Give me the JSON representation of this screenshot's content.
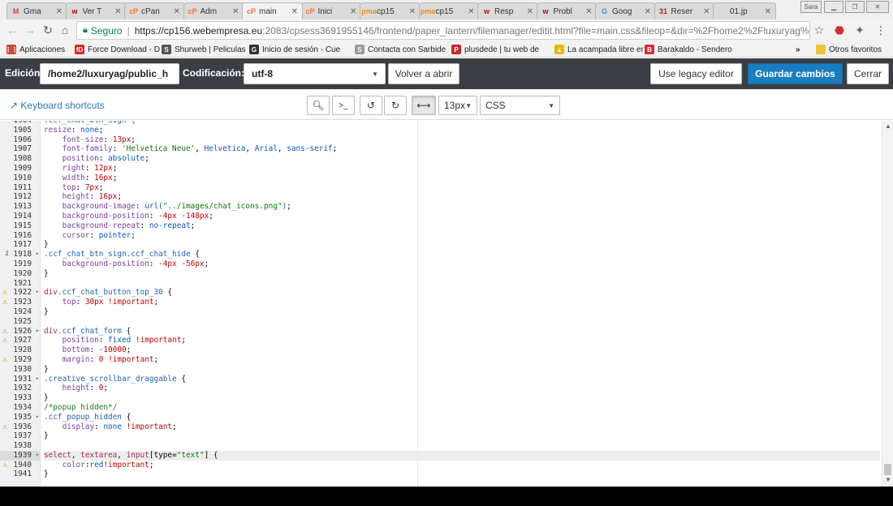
{
  "tabs": [
    {
      "label": "Gma",
      "icon": "gmail-icon",
      "fav": "M",
      "color": "#d44638"
    },
    {
      "label": "Ver T",
      "icon": "webempresa-icon",
      "fav": "w",
      "color": "#cc0000"
    },
    {
      "label": "cPan",
      "icon": "cpanel-icon",
      "fav": "cP",
      "color": "#ff6c2c"
    },
    {
      "label": "Adm",
      "icon": "cpanel-icon",
      "fav": "cP",
      "color": "#ff6c2c"
    },
    {
      "label": "main",
      "icon": "cpanel-icon",
      "fav": "cP",
      "color": "#ff6c2c"
    },
    {
      "label": "Inici",
      "icon": "cpanel-icon",
      "fav": "cP",
      "color": "#ff6c2c"
    },
    {
      "label": "cp15",
      "icon": "phpmyadmin-icon",
      "fav": "pma",
      "color": "#f29111"
    },
    {
      "label": "cp15",
      "icon": "phpmyadmin-icon",
      "fav": "pma",
      "color": "#f29111"
    },
    {
      "label": "Resp",
      "icon": "webempresa-icon",
      "fav": "w",
      "color": "#cc0000"
    },
    {
      "label": "Probl",
      "icon": "webempresa-icon",
      "fav": "w",
      "color": "#cc0000"
    },
    {
      "label": "Goog",
      "icon": "google-translate-icon",
      "fav": "G",
      "color": "#4285f4"
    },
    {
      "label": "Reser",
      "icon": "calendar-icon",
      "fav": "31",
      "color": "#b22222"
    },
    {
      "label": "01.jp",
      "icon": "image-icon",
      "fav": "",
      "color": "#888888"
    }
  ],
  "window": {
    "user": "Sara"
  },
  "toolbar": {
    "secure_label": "Seguro",
    "url_main": "https://cp156.webempresa.eu",
    "url_rest": ":2083/cpsess3691955146/frontend/paper_lantern/filemanager/editit.html?file=main.css&fileop=&dir=%2Fhome2%2Fluxuryag%2..."
  },
  "bookmarks": [
    {
      "label": "Aplicaciones",
      "icon": "apps-icon",
      "fav": "⋮⋮",
      "color": "#d44638"
    },
    {
      "label": "Force Download - De",
      "icon": "force-download-icon",
      "fav": "fD",
      "color": "#e02424"
    },
    {
      "label": "Shurweb | Peliculas y",
      "icon": "shurweb-icon",
      "fav": "S",
      "color": "#555555"
    },
    {
      "label": "Inicio de sesión - Cue",
      "icon": "google-icon",
      "fav": "G",
      "color": "#333333"
    },
    {
      "label": "Contacta con Sarbide",
      "icon": "sarbide-icon",
      "fav": "S",
      "color": "#9a9a9a"
    },
    {
      "label": "plusdede | tu web de",
      "icon": "plusdede-icon",
      "fav": "P",
      "color": "#c62828"
    },
    {
      "label": "La acampada libre en",
      "icon": "acampada-icon",
      "fav": "▲",
      "color": "#f0b400"
    },
    {
      "label": "Barakaldo - Sendero",
      "icon": "barakaldo-icon",
      "fav": "B",
      "color": "#d32f2f"
    },
    {
      "label": "»",
      "icon": "more-bookmarks-icon",
      "fav": "",
      "color": "#333333"
    },
    {
      "label": "Otros favoritos",
      "icon": "folder-icon",
      "fav": "",
      "color": "#f4c430"
    }
  ],
  "editbar": {
    "edition_label": "Edición:",
    "path_value": "/home2/luxuryag/public_h",
    "encoding_label": "Codificación:",
    "encoding_value": "utf-8",
    "reopen_label": "Volver a abrir",
    "legacy_label": "Use legacy editor",
    "save_label": "Guardar cambios",
    "close_label": "Cerrar"
  },
  "subbar": {
    "keyboard_shortcuts": "Keyboard shortcuts",
    "font_size": "13px",
    "mode": "CSS"
  },
  "code_lines": [
    {
      "n": "1904",
      "ann": "",
      "fold": "▾",
      "code": [
        [
          "t-cls",
          ".ccf_chat_btn_sign {"
        ]
      ]
    },
    {
      "n": "1905",
      "ann": "",
      "fold": "",
      "code": [
        [
          "t-prop",
          "resize"
        ],
        [
          "",
          ": "
        ],
        [
          "t-val",
          "none"
        ],
        [
          "",
          ";"
        ]
      ]
    },
    {
      "n": "1906",
      "ann": "",
      "fold": "",
      "code": [
        [
          "",
          "    "
        ],
        [
          "t-prop",
          "font-size"
        ],
        [
          "",
          ": "
        ],
        [
          "t-num",
          "13px"
        ],
        [
          "",
          ";"
        ]
      ]
    },
    {
      "n": "1907",
      "ann": "",
      "fold": "",
      "code": [
        [
          "",
          "    "
        ],
        [
          "t-prop",
          "font-family"
        ],
        [
          "",
          ": "
        ],
        [
          "t-str",
          "'Helvetica Neue'"
        ],
        [
          "",
          ", "
        ],
        [
          "t-val",
          "Helvetica"
        ],
        [
          "",
          ", "
        ],
        [
          "t-val",
          "Arial"
        ],
        [
          "",
          ", "
        ],
        [
          "t-val",
          "sans-serif"
        ],
        [
          "",
          ";"
        ]
      ]
    },
    {
      "n": "1908",
      "ann": "",
      "fold": "",
      "code": [
        [
          "",
          "    "
        ],
        [
          "t-prop",
          "position"
        ],
        [
          "",
          ": "
        ],
        [
          "t-val",
          "absolute"
        ],
        [
          "",
          ";"
        ]
      ]
    },
    {
      "n": "1909",
      "ann": "",
      "fold": "",
      "code": [
        [
          "",
          "    "
        ],
        [
          "t-prop",
          "right"
        ],
        [
          "",
          ": "
        ],
        [
          "t-num",
          "12px"
        ],
        [
          "",
          ";"
        ]
      ]
    },
    {
      "n": "1910",
      "ann": "",
      "fold": "",
      "code": [
        [
          "",
          "    "
        ],
        [
          "t-prop",
          "width"
        ],
        [
          "",
          ": "
        ],
        [
          "t-num",
          "16px"
        ],
        [
          "",
          ";"
        ]
      ]
    },
    {
      "n": "1911",
      "ann": "",
      "fold": "",
      "code": [
        [
          "",
          "    "
        ],
        [
          "t-prop",
          "top"
        ],
        [
          "",
          ": "
        ],
        [
          "t-num",
          "7px"
        ],
        [
          "",
          ";"
        ]
      ]
    },
    {
      "n": "1912",
      "ann": "",
      "fold": "",
      "code": [
        [
          "",
          "    "
        ],
        [
          "t-prop",
          "height"
        ],
        [
          "",
          ": "
        ],
        [
          "t-num",
          "16px"
        ],
        [
          "",
          ";"
        ]
      ]
    },
    {
      "n": "1913",
      "ann": "",
      "fold": "",
      "code": [
        [
          "",
          "    "
        ],
        [
          "t-prop",
          "background-image"
        ],
        [
          "",
          ": "
        ],
        [
          "t-val",
          "url("
        ],
        [
          "t-str",
          "\"../images/chat_icons.png\""
        ],
        [
          "t-val",
          ")"
        ],
        [
          "",
          ";"
        ]
      ]
    },
    {
      "n": "1914",
      "ann": "",
      "fold": "",
      "code": [
        [
          "",
          "    "
        ],
        [
          "t-prop",
          "background-position"
        ],
        [
          "",
          ": "
        ],
        [
          "t-num",
          "-4px -148px"
        ],
        [
          "",
          ";"
        ]
      ]
    },
    {
      "n": "1915",
      "ann": "",
      "fold": "",
      "code": [
        [
          "",
          "    "
        ],
        [
          "t-prop",
          "background-repeat"
        ],
        [
          "",
          ": "
        ],
        [
          "t-val",
          "no-repeat"
        ],
        [
          "",
          ";"
        ]
      ]
    },
    {
      "n": "1916",
      "ann": "",
      "fold": "",
      "code": [
        [
          "",
          "    "
        ],
        [
          "t-prop",
          "cursor"
        ],
        [
          "",
          ": "
        ],
        [
          "t-val",
          "pointer"
        ],
        [
          "",
          ";"
        ]
      ]
    },
    {
      "n": "1917",
      "ann": "",
      "fold": "",
      "code": [
        [
          "",
          "}"
        ]
      ]
    },
    {
      "n": "1918",
      "ann": "info",
      "fold": "▾",
      "code": [
        [
          "t-cls",
          ".ccf_chat_btn_sign.ccf_chat_hide"
        ],
        [
          "",
          " {"
        ]
      ]
    },
    {
      "n": "1919",
      "ann": "",
      "fold": "",
      "code": [
        [
          "",
          "    "
        ],
        [
          "t-prop",
          "background-position"
        ],
        [
          "",
          ": "
        ],
        [
          "t-num",
          "-4px -56px"
        ],
        [
          "",
          ";"
        ]
      ]
    },
    {
      "n": "1920",
      "ann": "",
      "fold": "",
      "code": [
        [
          "",
          "}"
        ]
      ]
    },
    {
      "n": "1921",
      "ann": "",
      "fold": "",
      "code": []
    },
    {
      "n": "1922",
      "ann": "warn",
      "fold": "▾",
      "code": [
        [
          "t-kw",
          "div"
        ],
        [
          "t-cls",
          ".ccf_chat_button_top_30"
        ],
        [
          "",
          " {"
        ]
      ]
    },
    {
      "n": "1923",
      "ann": "warn",
      "fold": "",
      "code": [
        [
          "",
          "    "
        ],
        [
          "t-prop",
          "top"
        ],
        [
          "",
          ": "
        ],
        [
          "t-num",
          "30px"
        ],
        [
          "",
          " "
        ],
        [
          "t-imp",
          "!important"
        ],
        [
          "",
          ";"
        ]
      ]
    },
    {
      "n": "1924",
      "ann": "",
      "fold": "",
      "code": [
        [
          "",
          "}"
        ]
      ]
    },
    {
      "n": "1925",
      "ann": "",
      "fold": "",
      "code": []
    },
    {
      "n": "1926",
      "ann": "warn",
      "fold": "▾",
      "code": [
        [
          "t-kw",
          "div"
        ],
        [
          "t-cls",
          ".ccf_chat_form"
        ],
        [
          "",
          " {"
        ]
      ]
    },
    {
      "n": "1927",
      "ann": "warn",
      "fold": "",
      "code": [
        [
          "",
          "    "
        ],
        [
          "t-prop",
          "position"
        ],
        [
          "",
          ": "
        ],
        [
          "t-val",
          "fixed"
        ],
        [
          "",
          " "
        ],
        [
          "t-imp",
          "!important"
        ],
        [
          "",
          ";"
        ]
      ]
    },
    {
      "n": "1928",
      "ann": "",
      "fold": "",
      "code": [
        [
          "",
          "    "
        ],
        [
          "t-prop",
          "bottom"
        ],
        [
          "",
          ": "
        ],
        [
          "t-num",
          "-10000"
        ],
        [
          "",
          ";"
        ]
      ]
    },
    {
      "n": "1929",
      "ann": "warn",
      "fold": "",
      "code": [
        [
          "",
          "    "
        ],
        [
          "t-prop",
          "margin"
        ],
        [
          "",
          ": "
        ],
        [
          "t-num",
          "0"
        ],
        [
          "",
          " "
        ],
        [
          "t-imp",
          "!important"
        ],
        [
          "",
          ";"
        ]
      ]
    },
    {
      "n": "1930",
      "ann": "",
      "fold": "",
      "code": [
        [
          "",
          "}"
        ]
      ]
    },
    {
      "n": "1931",
      "ann": "",
      "fold": "▾",
      "code": [
        [
          "t-cls",
          ".creative_scrollbar_draggable"
        ],
        [
          "",
          " {"
        ]
      ]
    },
    {
      "n": "1932",
      "ann": "",
      "fold": "",
      "code": [
        [
          "",
          "    "
        ],
        [
          "t-prop",
          "height"
        ],
        [
          "",
          ": "
        ],
        [
          "t-num",
          "0"
        ],
        [
          "",
          ";"
        ]
      ]
    },
    {
      "n": "1933",
      "ann": "",
      "fold": "",
      "code": [
        [
          "",
          "}"
        ]
      ]
    },
    {
      "n": "1934",
      "ann": "",
      "fold": "",
      "code": [
        [
          "t-cmt",
          "/*popup hidden*/"
        ]
      ]
    },
    {
      "n": "1935",
      "ann": "",
      "fold": "▾",
      "code": [
        [
          "t-cls",
          ".ccf_popup_hidden"
        ],
        [
          "",
          " {"
        ]
      ]
    },
    {
      "n": "1936",
      "ann": "warn",
      "fold": "",
      "code": [
        [
          "",
          "    "
        ],
        [
          "t-prop",
          "display"
        ],
        [
          "",
          ": "
        ],
        [
          "t-val",
          "none"
        ],
        [
          "",
          " "
        ],
        [
          "t-imp",
          "!important"
        ],
        [
          "",
          ";"
        ]
      ]
    },
    {
      "n": "1937",
      "ann": "",
      "fold": "",
      "code": [
        [
          "",
          "}"
        ]
      ]
    },
    {
      "n": "1938",
      "ann": "",
      "fold": "",
      "code": []
    },
    {
      "n": "1939",
      "ann": "",
      "fold": "▾",
      "code": [
        [
          "t-kw",
          "select"
        ],
        [
          "",
          ", "
        ],
        [
          "t-kw",
          "textarea"
        ],
        [
          "",
          ", "
        ],
        [
          "t-kw",
          "input"
        ],
        [
          "",
          "[type="
        ],
        [
          "t-str",
          "\"text\""
        ],
        [
          "",
          "] {"
        ]
      ],
      "current": true
    },
    {
      "n": "1940",
      "ann": "warn",
      "fold": "",
      "code": [
        [
          "",
          "    "
        ],
        [
          "t-prop",
          "color"
        ],
        [
          "",
          ":"
        ],
        [
          "t-val",
          "red"
        ],
        [
          "t-imp",
          "!important"
        ],
        [
          "",
          ";"
        ]
      ]
    },
    {
      "n": "1941",
      "ann": "",
      "fold": "",
      "code": [
        [
          "",
          "}"
        ]
      ]
    }
  ]
}
